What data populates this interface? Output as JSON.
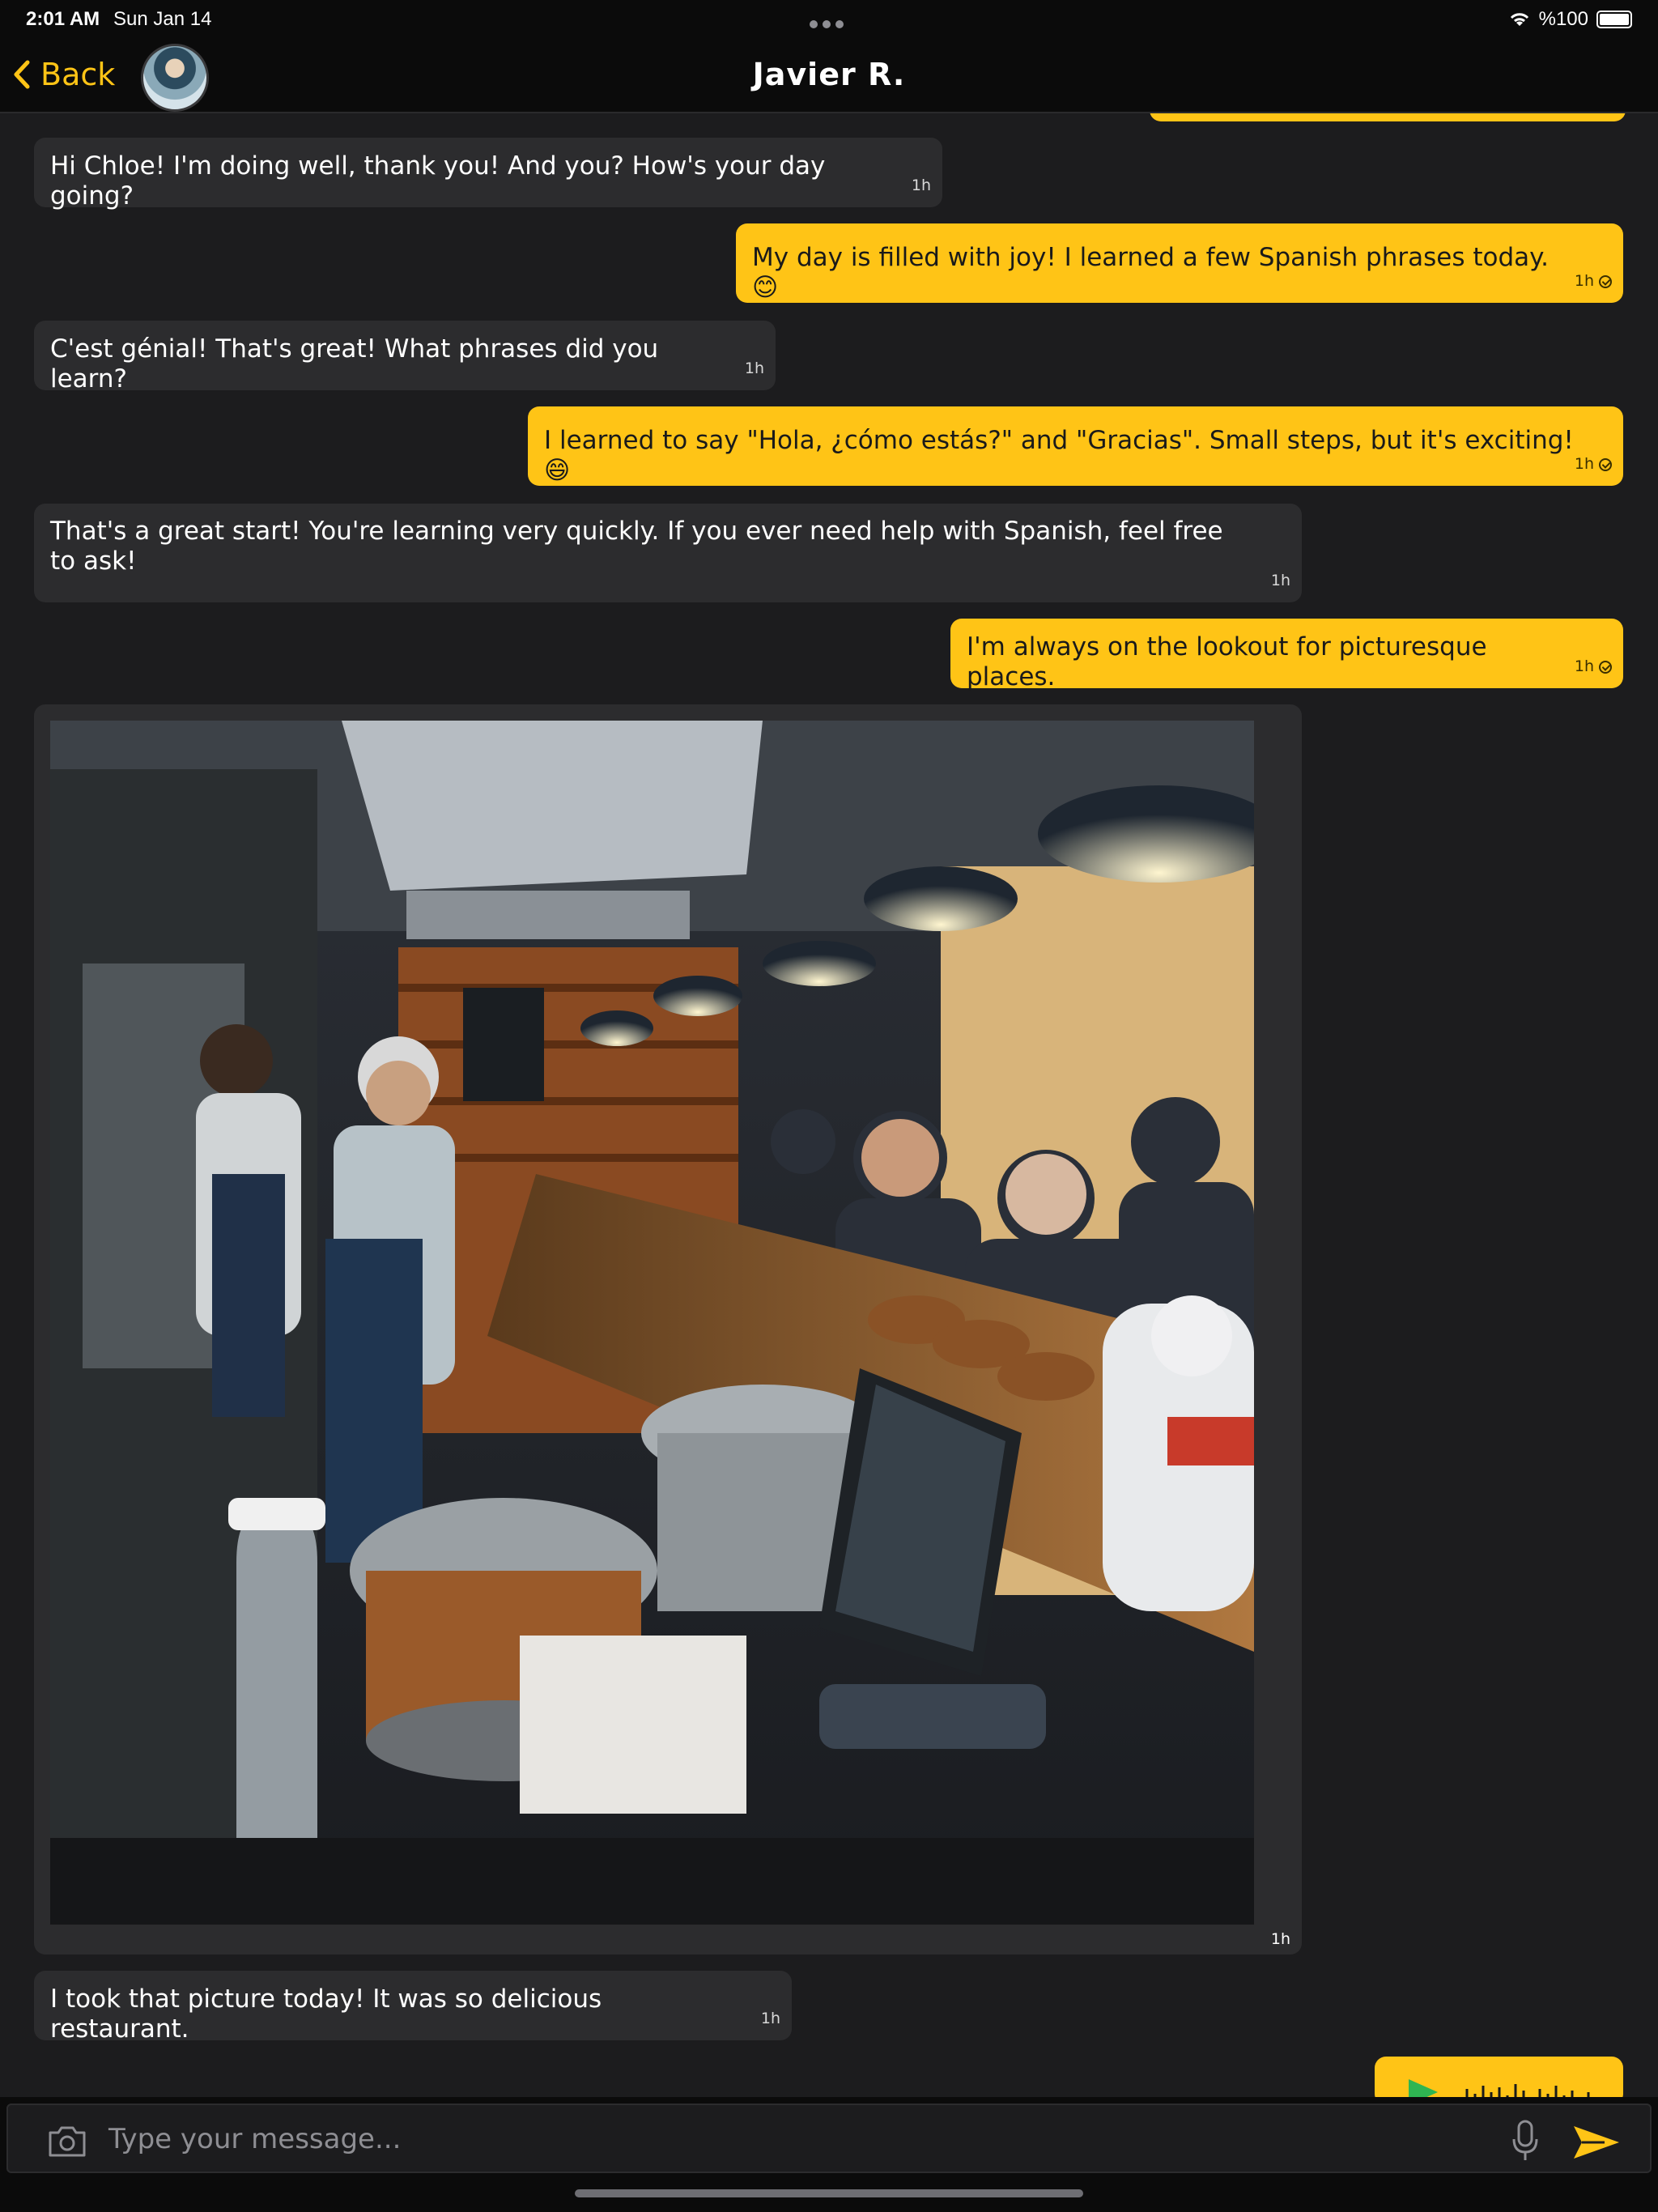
{
  "status": {
    "time": "2:01 AM",
    "date": "Sun Jan 14",
    "battery": "%100"
  },
  "nav": {
    "back_label": "Back",
    "title": "Javier R."
  },
  "messages": [
    {
      "dir": "in",
      "text": "Hi Chloe! I'm doing well, thank you! And you? How's your day going?",
      "time": "1h"
    },
    {
      "dir": "out",
      "text": "My day is filled with joy! I learned a few Spanish phrases today. 😊",
      "time": "1h"
    },
    {
      "dir": "in",
      "text": "C'est génial! That's great! What phrases did you learn?",
      "time": "1h"
    },
    {
      "dir": "out",
      "text": "I learned to say \"Hola, ¿cómo estás?\" and \"Gracias\". Small steps, but it's exciting! 😄",
      "time": "1h"
    },
    {
      "dir": "in",
      "text": "That's a great start! You're learning very quickly. If you ever need help with Spanish, feel free to ask!",
      "time": "1h"
    },
    {
      "dir": "out",
      "text": "I'm always on the lookout for picturesque places.",
      "time": "1h"
    },
    {
      "dir": "in",
      "type": "image",
      "time": "1h"
    },
    {
      "dir": "in",
      "text": "I took that picture today! It was so delicious restaurant.",
      "time": "1h"
    }
  ],
  "input": {
    "placeholder": "Type your message..."
  },
  "colors": {
    "accent": "#ffc416",
    "incoming": "#2c2c2e",
    "background": "#1c1c1e"
  }
}
